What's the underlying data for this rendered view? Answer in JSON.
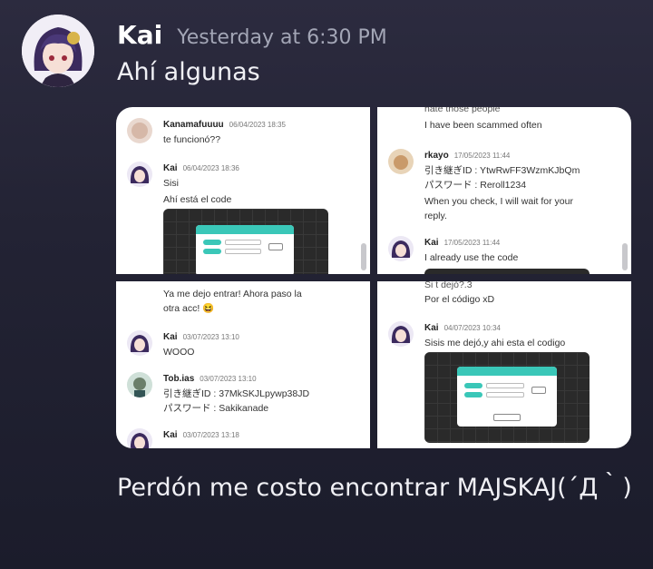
{
  "message": {
    "username": "Kai",
    "timestamp": "Yesterday at 6:30 PM",
    "text": "Ahí algunas",
    "followup_text": "Perdón me costo encontrar MAJSKAJ(´Д｀)"
  },
  "tiles": {
    "t1": {
      "m1": {
        "name": "Kanamafuuuu",
        "date": "06/04/2023 18:35",
        "lines": [
          "te funcionó??"
        ]
      },
      "m2": {
        "name": "Kai",
        "date": "06/04/2023 18:36",
        "lines": [
          "Sisi",
          "Ahí está el code"
        ]
      }
    },
    "t2": {
      "cut_top": "hate those people",
      "line_top": "I have been scammed often",
      "m1": {
        "name": "rkayo",
        "date": "17/05/2023 11:44",
        "lines": [
          "引き継ぎID : YtwRwFF3WzmKJbQm",
          "パスワード : Reroll1234",
          "When you check, I will wait for your",
          "reply."
        ]
      },
      "m2": {
        "name": "Kai",
        "date": "17/05/2023 11:44",
        "lines": [
          "I already use the code"
        ]
      }
    },
    "t3": {
      "line_top1": "Ya me dejo entrar! Ahora paso la",
      "line_top2": "otra acc! 😆",
      "m1": {
        "name": "Kai",
        "date": "03/07/2023 13:10",
        "lines": [
          "WOOO"
        ]
      },
      "m2": {
        "name": "Tob.ias",
        "date": "03/07/2023 13:10",
        "lines": [
          "引き継ぎID : 37MkSKJLpywp38JD",
          "パスワード : Sakikanade"
        ]
      },
      "m3": {
        "name": "Kai",
        "date": "03/07/2023 13:18",
        "lines": []
      }
    },
    "t4": {
      "cut_top": "Si t dejó?.3",
      "line_top": "Por el código xD",
      "m1": {
        "name": "Kai",
        "date": "04/07/2023 10:34",
        "lines": [
          "Sisis me dejó,y ahi esta el codigo"
        ]
      }
    }
  },
  "colors": {
    "accent": "#3ac7b8",
    "background": "#232334"
  }
}
